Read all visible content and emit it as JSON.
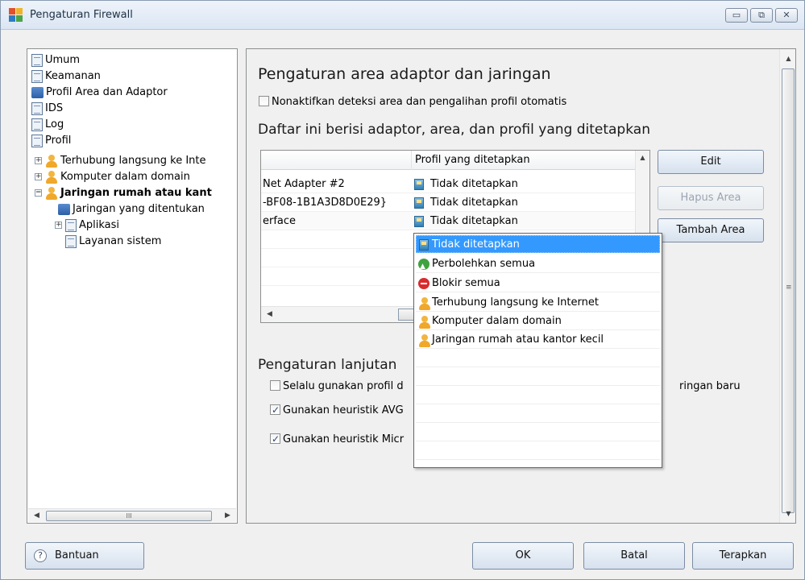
{
  "window": {
    "title": "Pengaturan Firewall",
    "controls": {
      "minimize": "▭",
      "restore": "⧉",
      "close": "✕"
    }
  },
  "tree": {
    "items": [
      {
        "label": "Umum"
      },
      {
        "label": "Keamanan"
      },
      {
        "label": "Profil Area dan Adaptor"
      },
      {
        "label": "IDS"
      },
      {
        "label": "Log"
      },
      {
        "label": "Profil"
      },
      {
        "label": "Terhubung langsung ke Inte"
      },
      {
        "label": "Komputer dalam domain"
      },
      {
        "label": "Jaringan rumah atau kant"
      },
      {
        "label": "Jaringan yang ditentukan"
      },
      {
        "label": "Aplikasi"
      },
      {
        "label": "Layanan sistem"
      }
    ],
    "hscroll_grip": "III"
  },
  "panel": {
    "heading": "Pengaturan area adaptor dan jaringan",
    "disable_detection_label": "Nonaktifkan deteksi area dan pengalihan profil otomatis",
    "list_heading": "Daftar ini berisi adaptor, area, dan profil yang ditetapkan",
    "grid": {
      "column_profile": "Profil yang ditetapkan",
      "rows": [
        {
          "adapter": "Net Adapter #2",
          "profile": "Tidak ditetapkan"
        },
        {
          "adapter": "-BF08-1B1A3D8D0E29}",
          "profile": "Tidak ditetapkan"
        },
        {
          "adapter": "erface",
          "profile": "Tidak ditetapkan"
        }
      ]
    },
    "buttons": {
      "edit": "Edit",
      "remove_area": "Hapus Area",
      "add_area": "Tambah Area"
    },
    "advanced_heading": "Pengaturan lanjutan",
    "advanced_options": [
      {
        "label": "Selalu gunakan profil d",
        "checked": false
      },
      {
        "label": "Gunakan heuristik AVG",
        "checked": true
      },
      {
        "label": "Gunakan heuristik Micr",
        "checked": true
      }
    ],
    "advanced_option_tail": "ringan baru"
  },
  "dropdown": {
    "items": [
      {
        "label": "Tidak ditetapkan",
        "icon": "tag-icon",
        "selected": true
      },
      {
        "label": "Perbolehkan semua",
        "icon": "allow-icon",
        "selected": false
      },
      {
        "label": "Blokir semua",
        "icon": "block-icon",
        "selected": false
      },
      {
        "label": "Terhubung langsung ke Internet",
        "icon": "person-icon",
        "selected": false
      },
      {
        "label": "Komputer dalam domain",
        "icon": "person-icon",
        "selected": false
      },
      {
        "label": "Jaringan rumah atau kantor kecil",
        "icon": "person-icon",
        "selected": false
      }
    ]
  },
  "footer": {
    "help": "Bantuan",
    "ok": "OK",
    "cancel": "Batal",
    "apply": "Terapkan"
  },
  "colors": {
    "selection": "#3399ff",
    "brand": "#e2512a"
  }
}
